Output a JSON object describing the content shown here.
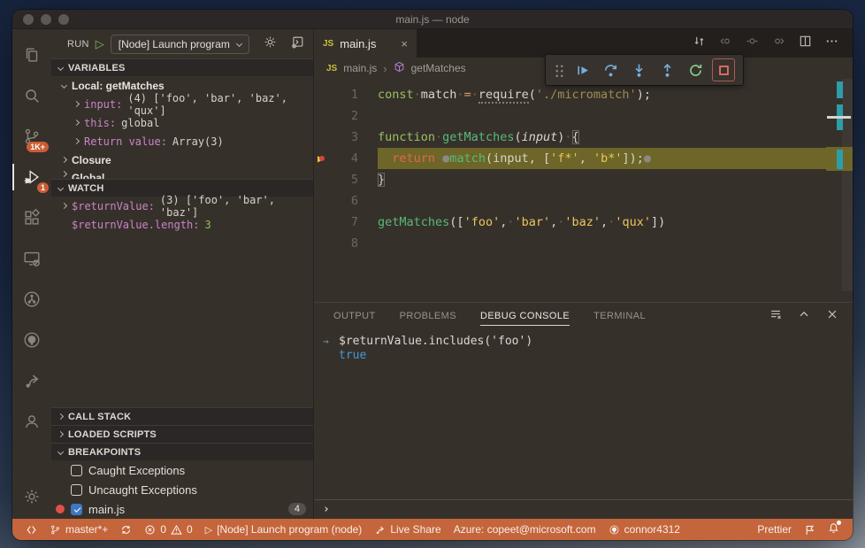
{
  "window": {
    "title": "main.js — node"
  },
  "activity_bar": {
    "items": [
      {
        "icon": "files",
        "name": "explorer"
      },
      {
        "icon": "search",
        "name": "search"
      },
      {
        "icon": "branch",
        "name": "source-control",
        "badge": "1K+"
      },
      {
        "icon": "debug",
        "name": "run-and-debug",
        "badge": "1",
        "active": true
      },
      {
        "icon": "extensions",
        "name": "extensions"
      },
      {
        "icon": "remote",
        "name": "remote-explorer"
      },
      {
        "icon": "azure",
        "name": "azure-pipelines"
      },
      {
        "icon": "github",
        "name": "github"
      },
      {
        "icon": "liveshare",
        "name": "live-share"
      },
      {
        "icon": "account",
        "name": "accounts"
      }
    ],
    "bottom": [
      {
        "icon": "gear",
        "name": "settings"
      }
    ]
  },
  "sidebar": {
    "run": {
      "label": "RUN",
      "play_glyph": "▷",
      "config": "[Node] Launch program",
      "actions": [
        {
          "icon": "gear",
          "name": "launch-configure"
        },
        {
          "icon": "console-open",
          "name": "open-debug-console"
        }
      ]
    },
    "variables": {
      "title": "VARIABLES",
      "rows": [
        {
          "type": "scope",
          "chevron": "down",
          "label": "Local: getMatches",
          "indent": 1
        },
        {
          "type": "var",
          "chevron": "right",
          "name": "input:",
          "value": "(4) ['foo', 'bar', 'baz', 'qux']",
          "indent": 2
        },
        {
          "type": "var",
          "chevron": "right",
          "name": "this:",
          "value": "global",
          "indent": 2
        },
        {
          "type": "var",
          "chevron": "right",
          "name": "Return value:",
          "value": "Array(3)",
          "indent": 2
        },
        {
          "type": "scope",
          "chevron": "right",
          "label": "Closure",
          "indent": 1
        },
        {
          "type": "scope",
          "chevron": "right",
          "label": "Global",
          "indent": 1,
          "clipped": true
        }
      ]
    },
    "watch": {
      "title": "WATCH",
      "rows": [
        {
          "type": "var",
          "chevron": "right",
          "name": "$returnValue:",
          "value": "(3) ['foo', 'bar', 'baz']",
          "indent": 1
        },
        {
          "type": "var",
          "name": "$returnValue.length:",
          "value": "3",
          "num": true,
          "indent": 1
        }
      ]
    },
    "call_stack": {
      "title": "CALL STACK"
    },
    "loaded_scripts": {
      "title": "LOADED SCRIPTS"
    },
    "breakpoints": {
      "title": "BREAKPOINTS",
      "rows": [
        {
          "label": "Caught Exceptions",
          "checked": false
        },
        {
          "label": "Uncaught Exceptions",
          "checked": false
        },
        {
          "label": "main.js",
          "checked": true,
          "breakpoint_dot": true,
          "badge": "4"
        }
      ]
    }
  },
  "editor": {
    "tab": {
      "badge": "JS",
      "label": "main.js",
      "close_glyph": "×"
    },
    "breadcrumbs": {
      "file_badge": "JS",
      "file": "main.js",
      "sep": "›",
      "symbol": "getMatches"
    },
    "title_actions": [
      {
        "icon": "diff",
        "name": "open-changes",
        "dim": false
      },
      {
        "icon": "nav-back",
        "name": "reverse-continue",
        "dim": true
      },
      {
        "icon": "nav-dot",
        "name": "debug-step-marker",
        "dim": true
      },
      {
        "icon": "nav-fwd",
        "name": "continue-to-here",
        "dim": true
      },
      {
        "icon": "split",
        "name": "split-editor",
        "dim": false
      },
      {
        "icon": "more",
        "name": "more-actions",
        "dim": false
      }
    ],
    "current_line": 4,
    "lines": [
      {
        "n": "1",
        "segs": [
          [
            "const",
            "kw"
          ],
          [
            "·",
            "ws"
          ],
          [
            "match",
            "pl"
          ],
          [
            "·",
            "ws"
          ],
          [
            "=",
            "op"
          ],
          [
            "·",
            "ws"
          ],
          [
            "require",
            "req"
          ],
          [
            "(",
            "pl"
          ],
          [
            "'./micromatch'",
            "strd"
          ],
          [
            ");",
            "pl"
          ]
        ]
      },
      {
        "n": "2",
        "segs": []
      },
      {
        "n": "3",
        "segs": [
          [
            "function",
            "kw"
          ],
          [
            "·",
            "ws"
          ],
          [
            "getMatches",
            "fn"
          ],
          [
            "(",
            "pl"
          ],
          [
            "input",
            "param"
          ],
          [
            ")",
            "pl"
          ],
          [
            "·",
            "ws"
          ],
          [
            "{",
            "brk"
          ]
        ]
      },
      {
        "n": "4",
        "segs": [
          [
            "··",
            "ws"
          ],
          [
            "return",
            "ret"
          ],
          [
            "·",
            "ws"
          ],
          [
            "●",
            "bp"
          ],
          [
            "match",
            "fn"
          ],
          [
            "(",
            "pl"
          ],
          [
            "input",
            "pl"
          ],
          [
            ",",
            "pl"
          ],
          [
            "·",
            "ws"
          ],
          [
            "[",
            "pl"
          ],
          [
            "'f*'",
            "str"
          ],
          [
            ",",
            "pl"
          ],
          [
            "·",
            "ws"
          ],
          [
            "'b*'",
            "str"
          ],
          [
            "]",
            "pl"
          ],
          [
            ");",
            "pl"
          ],
          [
            "●",
            "bp"
          ]
        ]
      },
      {
        "n": "5",
        "segs": [
          [
            "}",
            "brk"
          ]
        ]
      },
      {
        "n": "6",
        "segs": []
      },
      {
        "n": "7",
        "segs": [
          [
            "getMatches",
            "fn"
          ],
          [
            "(",
            "pl"
          ],
          [
            "[",
            "pl"
          ],
          [
            "'foo'",
            "str"
          ],
          [
            ",",
            "pl"
          ],
          [
            "·",
            "ws"
          ],
          [
            "'bar'",
            "str"
          ],
          [
            ",",
            "pl"
          ],
          [
            "·",
            "ws"
          ],
          [
            "'baz'",
            "str"
          ],
          [
            ",",
            "pl"
          ],
          [
            "·",
            "ws"
          ],
          [
            "'qux'",
            "str"
          ],
          [
            "]",
            "pl"
          ],
          [
            ")",
            "pl"
          ]
        ]
      },
      {
        "n": "8",
        "segs": []
      }
    ]
  },
  "debug_toolbar": {
    "buttons": [
      {
        "icon": "continue",
        "name": "continue",
        "color": "blue"
      },
      {
        "icon": "step-over",
        "name": "step-over",
        "color": "blue"
      },
      {
        "icon": "step-into",
        "name": "step-into",
        "color": "blue"
      },
      {
        "icon": "step-out",
        "name": "step-out",
        "color": "blue"
      },
      {
        "icon": "restart",
        "name": "restart",
        "color": "green"
      },
      {
        "icon": "stop",
        "name": "stop",
        "color": "red"
      }
    ]
  },
  "panel": {
    "tabs": [
      {
        "label": "OUTPUT"
      },
      {
        "label": "PROBLEMS"
      },
      {
        "label": "DEBUG CONSOLE",
        "active": true
      },
      {
        "label": "TERMINAL"
      }
    ],
    "actions": [
      {
        "icon": "clear",
        "name": "clear-console"
      },
      {
        "icon": "chevup",
        "name": "maximize-panel"
      },
      {
        "icon": "close16",
        "name": "close-panel"
      }
    ],
    "console": {
      "gutter": "→",
      "expression": "$returnValue.includes('foo')",
      "result": "true"
    },
    "prompt": "›"
  },
  "status_bar": {
    "left": [
      {
        "name": "remote-indicator",
        "icon": "remote-sb"
      },
      {
        "name": "git-branch",
        "icon": "branch",
        "text": "master*+"
      },
      {
        "name": "sync",
        "icon": "sync"
      },
      {
        "name": "problems",
        "parts": [
          {
            "icon": "error",
            "text": "0"
          },
          {
            "icon": "warn",
            "text": "0"
          }
        ]
      },
      {
        "name": "debug-launch",
        "glyph": "▷",
        "text": "[Node] Launch program (node)"
      },
      {
        "name": "live-share",
        "icon": "liveshare",
        "text": "Live Share"
      },
      {
        "name": "azure-account",
        "text": "Azure: copeet@microsoft.com"
      },
      {
        "name": "github-account",
        "icon": "github",
        "text": "connor4312"
      }
    ],
    "right": [
      {
        "name": "prettier",
        "text": "Prettier"
      },
      {
        "name": "feedback",
        "icon": "feedback"
      },
      {
        "name": "notifications",
        "icon": "bell",
        "dot": true
      }
    ]
  }
}
